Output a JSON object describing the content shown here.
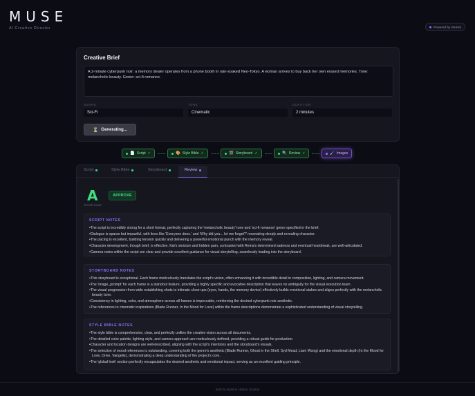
{
  "header": {
    "logo": "MUSE",
    "tagline": "AI Creative Director",
    "powered_by": "Powered by Gemini"
  },
  "brief": {
    "title": "Creative Brief",
    "text": "A 2-minute cyberpunk noir: a memory dealer operates from a phone booth in rain-soaked Neo-Tokyo. A woman arrives to buy back her own erased memories. Tone: melancholic beauty. Genre: sci-fi romance.",
    "genre_label": "GENRE",
    "genre_value": "Sci-Fi",
    "tone_label": "TONE",
    "tone_value": "Cinematic",
    "duration_label": "DURATION",
    "duration_value": "2 minutes",
    "generate_label": "Generating...",
    "generate_icon": "hourglass-icon"
  },
  "pipeline": {
    "steps": [
      {
        "icon": "📄",
        "label": "Script",
        "check": "✓"
      },
      {
        "icon": "🎨",
        "label": "Style Bible",
        "check": "✓"
      },
      {
        "icon": "🎬",
        "label": "Storyboard",
        "check": "✓"
      },
      {
        "icon": "🔍",
        "label": "Review",
        "check": "✓"
      },
      {
        "icon": "🖌️",
        "label": "Images",
        "check": ""
      }
    ]
  },
  "tabs": [
    {
      "label": "Script"
    },
    {
      "label": "Style Bible"
    },
    {
      "label": "Storyboard"
    },
    {
      "label": "Review"
    }
  ],
  "review": {
    "grade": "A",
    "grade_label": "Overall Grade",
    "verdict": "APPROVE",
    "script_notes": {
      "title": "SCRIPT NOTES",
      "items": [
        "The script is incredibly strong for a short format, perfectly capturing the 'melancholic beauty' tone and 'sci-fi romance' genre specified in the brief.",
        "Dialogue is sparse but impactful, with lines like 'Everyone does.' and 'Why did you... let me forget?' resonating deeply and revealing character.",
        "The pacing is excellent, building tension quickly and delivering a powerful emotional punch with the memory reveal.",
        "Character development, though brief, is effective. Kai's stoicism and hidden pain, contrasted with Reina's determined sadness and eventual heartbreak, are well-articulated.",
        "Camera notes within the script are clear and provide excellent guidance for visual storytelling, seamlessly leading into the storyboard."
      ]
    },
    "storyboard_notes": {
      "title": "STORYBOARD NOTES",
      "items": [
        "This storyboard is exceptional. Each frame meticulously translates the script's vision, often enhancing it with incredible detail in composition, lighting, and camera movement.",
        "The 'image_prompt' for each frame is a standout feature, providing a highly specific and evocative description that leaves no ambiguity for the visual execution team.",
        "The visual progression from wide establishing shots to intimate close-ups (eyes, hands, the memory device) effectively builds emotional stakes and aligns perfectly with the melancholic beauty tone.",
        "Consistency in lighting, color, and atmosphere across all frames is impeccable, reinforcing the desired cyberpunk noir aesthetic.",
        "The references to cinematic inspirations (Blade Runner, In the Mood for Love) within the frame descriptions demonstrate a sophisticated understanding of visual storytelling."
      ]
    },
    "style_notes": {
      "title": "STYLE BIBLE NOTES",
      "items": [
        "The style bible is comprehensive, clear, and perfectly unifies the creative vision across all documents.",
        "The detailed color palette, lighting style, and camera approach are meticulously defined, providing a robust guide for production.",
        "Character and location designs are well-described, aligning with the script's intentions and the storyboard's visuals.",
        "The selection of mood references is outstanding, covering both the genre's aesthetic (Blade Runner, Ghost in the Shell, Syd Mead, Liam Wong) and the emotional depth (In the Mood for Love, Drive, Vangelis), demonstrating a deep understanding of the project's core.",
        "The 'global look' section perfectly encapsulates the desired aesthetic and emotional impact, serving as an excellent guiding principle."
      ]
    }
  },
  "footer": {
    "text": "Built by Bastion Harbor Studios"
  },
  "colors": {
    "background": "#0c0c14",
    "accent": "#8a74ff",
    "success": "#3ee07e"
  }
}
